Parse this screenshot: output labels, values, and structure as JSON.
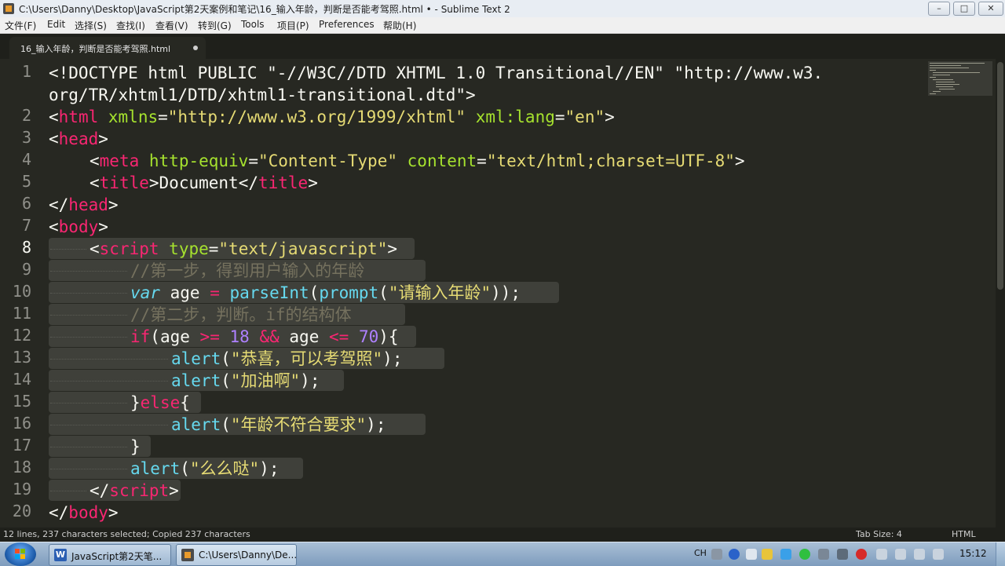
{
  "window": {
    "title": "C:\\Users\\Danny\\Desktop\\JavaScript第2天案例和笔记\\16_输入年龄，判断是否能考驾照.html • - Sublime Text 2",
    "minimize_glyph": "–",
    "maximize_glyph": "□",
    "close_glyph": "✕"
  },
  "menu": [
    "文件(F)",
    "Edit",
    "选择(S)",
    "查找(I)",
    "查看(V)",
    "转到(G)",
    "Tools",
    "项目(P)",
    "Preferences",
    "帮助(H)"
  ],
  "tab": {
    "label": "16_输入年龄，判断是否能考驾照.html",
    "modified": true
  },
  "editor": {
    "active_line": 8,
    "line_numbers": [
      "1",
      "",
      "2",
      "3",
      "4",
      "5",
      "6",
      "7",
      "8",
      "9",
      "10",
      "11",
      "12",
      "13",
      "14",
      "15",
      "16",
      "17",
      "18",
      "19",
      "20"
    ],
    "code": {
      "l1a": "<!DOCTYPE html PUBLIC \"-//W3C//DTD XHTML 1.0 Transitional//EN\" \"http://www.w3.",
      "l1b": "org/TR/xhtml1/DTD/xhtml1-transitional.dtd\">",
      "l2_tag": "html",
      "l2_attr1": "xmlns",
      "l2_val1": "\"http://www.w3.org/1999/xhtml\"",
      "l2_attr2": "xml:lang",
      "l2_val2": "\"en\"",
      "l3_tag": "head",
      "l4_tag": "meta",
      "l4_attr1": "http-equiv",
      "l4_val1": "\"Content-Type\"",
      "l4_attr2": "content",
      "l4_val2": "\"text/html;charset=UTF-8\"",
      "l5_tag": "title",
      "l5_text": "Document",
      "l6_tag": "head",
      "l7_tag": "body",
      "l8_tag": "script",
      "l8_attr": "type",
      "l8_val": "\"text/javascript\"",
      "l9_comment": "//第一步，得到用户输入的年龄",
      "l10_var": "var",
      "l10_name": "age",
      "l10_eq": "=",
      "l10_fn1": "parseInt",
      "l10_fn2": "prompt",
      "l10_str": "\"请输入年龄\"",
      "l11_comment": "//第二步，判断。if的结构体",
      "l12_kw": "if",
      "l12_a": "age",
      "l12_op1": ">=",
      "l12_n1": "18",
      "l12_op2": "&&",
      "l12_b": "age",
      "l12_op3": "<=",
      "l12_n2": "70",
      "l13_fn": "alert",
      "l13_str": "\"恭喜，可以考驾照\"",
      "l14_fn": "alert",
      "l14_str": "\"加油啊\"",
      "l15_kw": "else",
      "l16_fn": "alert",
      "l16_str": "\"年龄不符合要求\"",
      "l18_fn": "alert",
      "l18_str": "\"么么哒\"",
      "l19_tag": "script",
      "l20_tag": "body"
    }
  },
  "status": {
    "left": "12 lines, 237 characters selected; Copied 237 characters",
    "tab_size": "Tab Size: 4",
    "syntax": "HTML"
  },
  "taskbar": {
    "items": [
      {
        "label": "JavaScript第2天笔...",
        "icon": "word-icon",
        "icon_text": "W"
      },
      {
        "label": "C:\\Users\\Danny\\De...",
        "icon": "sublime-icon"
      }
    ],
    "tray_lang": "CH",
    "clock": "15:12"
  },
  "colors": {
    "editor_bg": "#272822",
    "tag": "#f92672",
    "attr": "#a6e22e",
    "string": "#e6db74",
    "function": "#66d9ef",
    "number": "#ae81ff",
    "comment": "#75715e"
  }
}
